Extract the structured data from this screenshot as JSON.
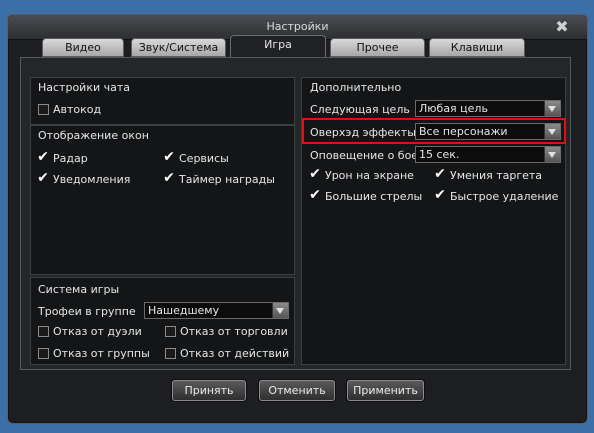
{
  "window": {
    "title": "Настройки"
  },
  "tabs": [
    {
      "label": "Видео"
    },
    {
      "label": "Звук/Система"
    },
    {
      "label": "Игра",
      "active": true
    },
    {
      "label": "Прочее"
    },
    {
      "label": "Клавиши"
    }
  ],
  "chat": {
    "header": "Настройки чата",
    "autocode": {
      "label": "Автокод",
      "checked": false
    }
  },
  "windows_display": {
    "header": "Отображение окон",
    "radar": {
      "label": "Радар",
      "checked": true
    },
    "services": {
      "label": "Сервисы",
      "checked": true
    },
    "notifications": {
      "label": "Уведомления",
      "checked": true
    },
    "reward_timer": {
      "label": "Таймер награды",
      "checked": true
    }
  },
  "game_system": {
    "header": "Система игры",
    "trophies": {
      "label": "Трофеи в группе",
      "value": "Нашедшему"
    },
    "refuse_duel": {
      "label": "Отказ от дуэли",
      "checked": false
    },
    "refuse_trade": {
      "label": "Отказ от торговли",
      "checked": false
    },
    "refuse_party": {
      "label": "Отказ от группы",
      "checked": false
    },
    "refuse_actions": {
      "label": "Отказ от действий",
      "checked": false
    }
  },
  "additional": {
    "header": "Дополнительно",
    "next_target": {
      "label": "Следующая цель",
      "value": "Любая цель"
    },
    "overhead_effects": {
      "label": "Оверхэд эффекты",
      "value": "Все персонажи"
    },
    "battle_alert": {
      "label": "Оповещение о бое",
      "value": "15 сек."
    },
    "screen_damage": {
      "label": "Урон на экране",
      "checked": true
    },
    "target_skills": {
      "label": "Умения таргета",
      "checked": true
    },
    "big_arrows": {
      "label": "Большие стрелы",
      "checked": true
    },
    "quick_delete": {
      "label": "Быстрое удаление",
      "checked": true
    }
  },
  "buttons": {
    "accept": "Принять",
    "cancel": "Отменить",
    "apply": "Применить"
  },
  "colors": {
    "highlight": "#e01010",
    "background": "#3b6fa6"
  },
  "icons": {
    "close": "close-icon",
    "checked": "checkmark-icon",
    "dropdown": "chevron-down-icon"
  }
}
